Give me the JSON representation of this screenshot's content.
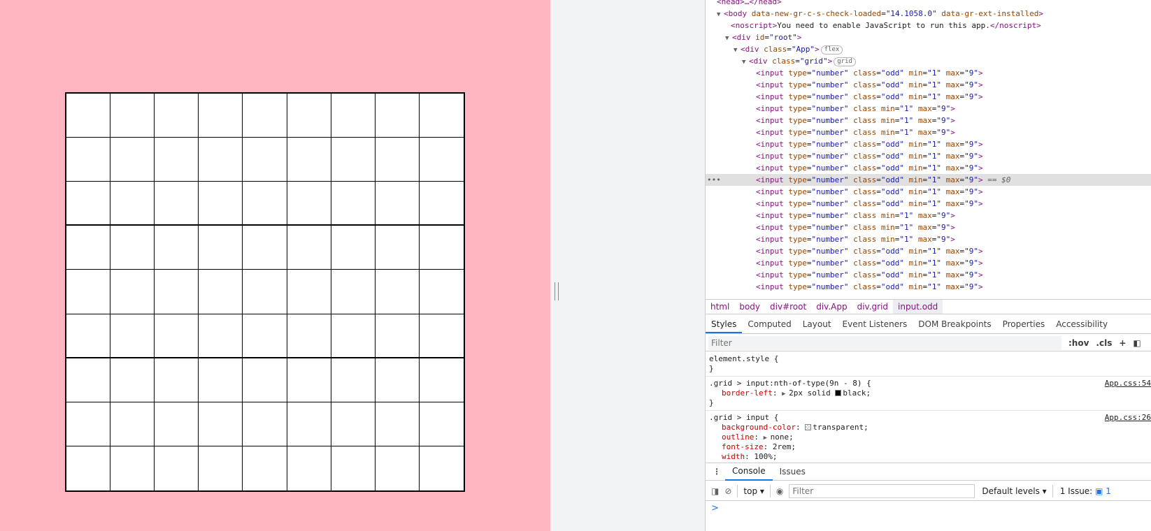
{
  "app": {
    "background_color": "#ffb6c1",
    "grid": {
      "rows": 9,
      "cols": 9,
      "cell_type": "number",
      "min": "1",
      "max": "9"
    }
  },
  "devtools": {
    "dom_lines": [
      {
        "indent": 1,
        "tri": "",
        "tag": "<head>",
        "text": "…</head>"
      },
      {
        "indent": 1,
        "tri": "▼",
        "html": "<span class='tag'>&lt;body</span> <span class='attr'>data-new-gr-c-s-check-loaded</span>=<span class='val'>\"14.1058.0\"</span> <span class='attr'>data-gr-ext-installed</span><span class='tag'>&gt;</span>"
      }
    ],
    "body_line": {
      "tag": "body",
      "attr1": "data-new-gr-c-s-check-loaded",
      "val1": "\"14.1058.0\"",
      "attr2": "data-gr-ext-installed"
    },
    "noscript_line": {
      "open": "<noscript>",
      "text": "You need to enable JavaScript to run this app.",
      "close": "</noscript>"
    },
    "root_line": {
      "tag": "div",
      "attr": "id",
      "val": "\"root\""
    },
    "app_line": {
      "tag": "div",
      "attr": "class",
      "val": "\"App\"",
      "badge": "flex"
    },
    "grid_line": {
      "tag": "div",
      "attr": "class",
      "val": "\"grid\"",
      "badge": "grid"
    },
    "input_lines": [
      {
        "cls": "=\"odd\""
      },
      {
        "cls": "=\"odd\""
      },
      {
        "cls": "=\"odd\""
      },
      {
        "cls": ""
      },
      {
        "cls": ""
      },
      {
        "cls": ""
      },
      {
        "cls": "=\"odd\""
      },
      {
        "cls": "=\"odd\""
      },
      {
        "cls": "=\"odd\""
      },
      {
        "cls": "=\"odd\"",
        "selected": true
      },
      {
        "cls": "=\"odd\""
      },
      {
        "cls": "=\"odd\""
      },
      {
        "cls": ""
      },
      {
        "cls": ""
      },
      {
        "cls": ""
      },
      {
        "cls": "=\"odd\""
      },
      {
        "cls": "=\"odd\""
      },
      {
        "cls": "=\"odd\""
      },
      {
        "cls": "=\"odd\""
      }
    ],
    "input_text": {
      "tag": "input",
      "type_attr": "type",
      "type_val": "\"number\"",
      "class_attr": "class",
      "min_attr": "min",
      "min_val": "\"1\"",
      "max_attr": "max",
      "max_val": "\"9\""
    },
    "selected_marker": "== $0",
    "head_text": "<head>…</head>",
    "breadcrumbs": [
      "html",
      "body",
      "div#root",
      "div.App",
      "div.grid",
      "input.odd"
    ],
    "panel_tabs": [
      "Styles",
      "Computed",
      "Layout",
      "Event Listeners",
      "DOM Breakpoints",
      "Properties",
      "Accessibility"
    ],
    "styles_filter_placeholder": "Filter",
    "styles_tools": [
      ":hov",
      ".cls",
      "+"
    ],
    "rules": {
      "element_style": {
        "selector": "element.style {",
        "close": "}"
      },
      "rule1": {
        "selector": ".grid > input:nth-of-type(9n - 8) {",
        "link": "App.css:54",
        "prop": "border-left",
        "value": "2px solid",
        "color_name": "black",
        "close": "}"
      },
      "rule2": {
        "selector": ".grid > input {",
        "link": "App.css:26",
        "props": [
          {
            "prop": "background-color",
            "value": "transparent",
            "swatch": true
          },
          {
            "prop": "outline",
            "value": "none",
            "tri": true
          },
          {
            "prop": "font-size",
            "value": "2rem"
          },
          {
            "prop": "width",
            "value": "100%"
          }
        ]
      }
    },
    "drawer_tabs": [
      "Console",
      "Issues"
    ],
    "console": {
      "context": "top",
      "filter_placeholder": "Filter",
      "levels": "Default levels",
      "issues_label": "1 Issue:",
      "issues_count": "1",
      "prompt": ">"
    }
  }
}
